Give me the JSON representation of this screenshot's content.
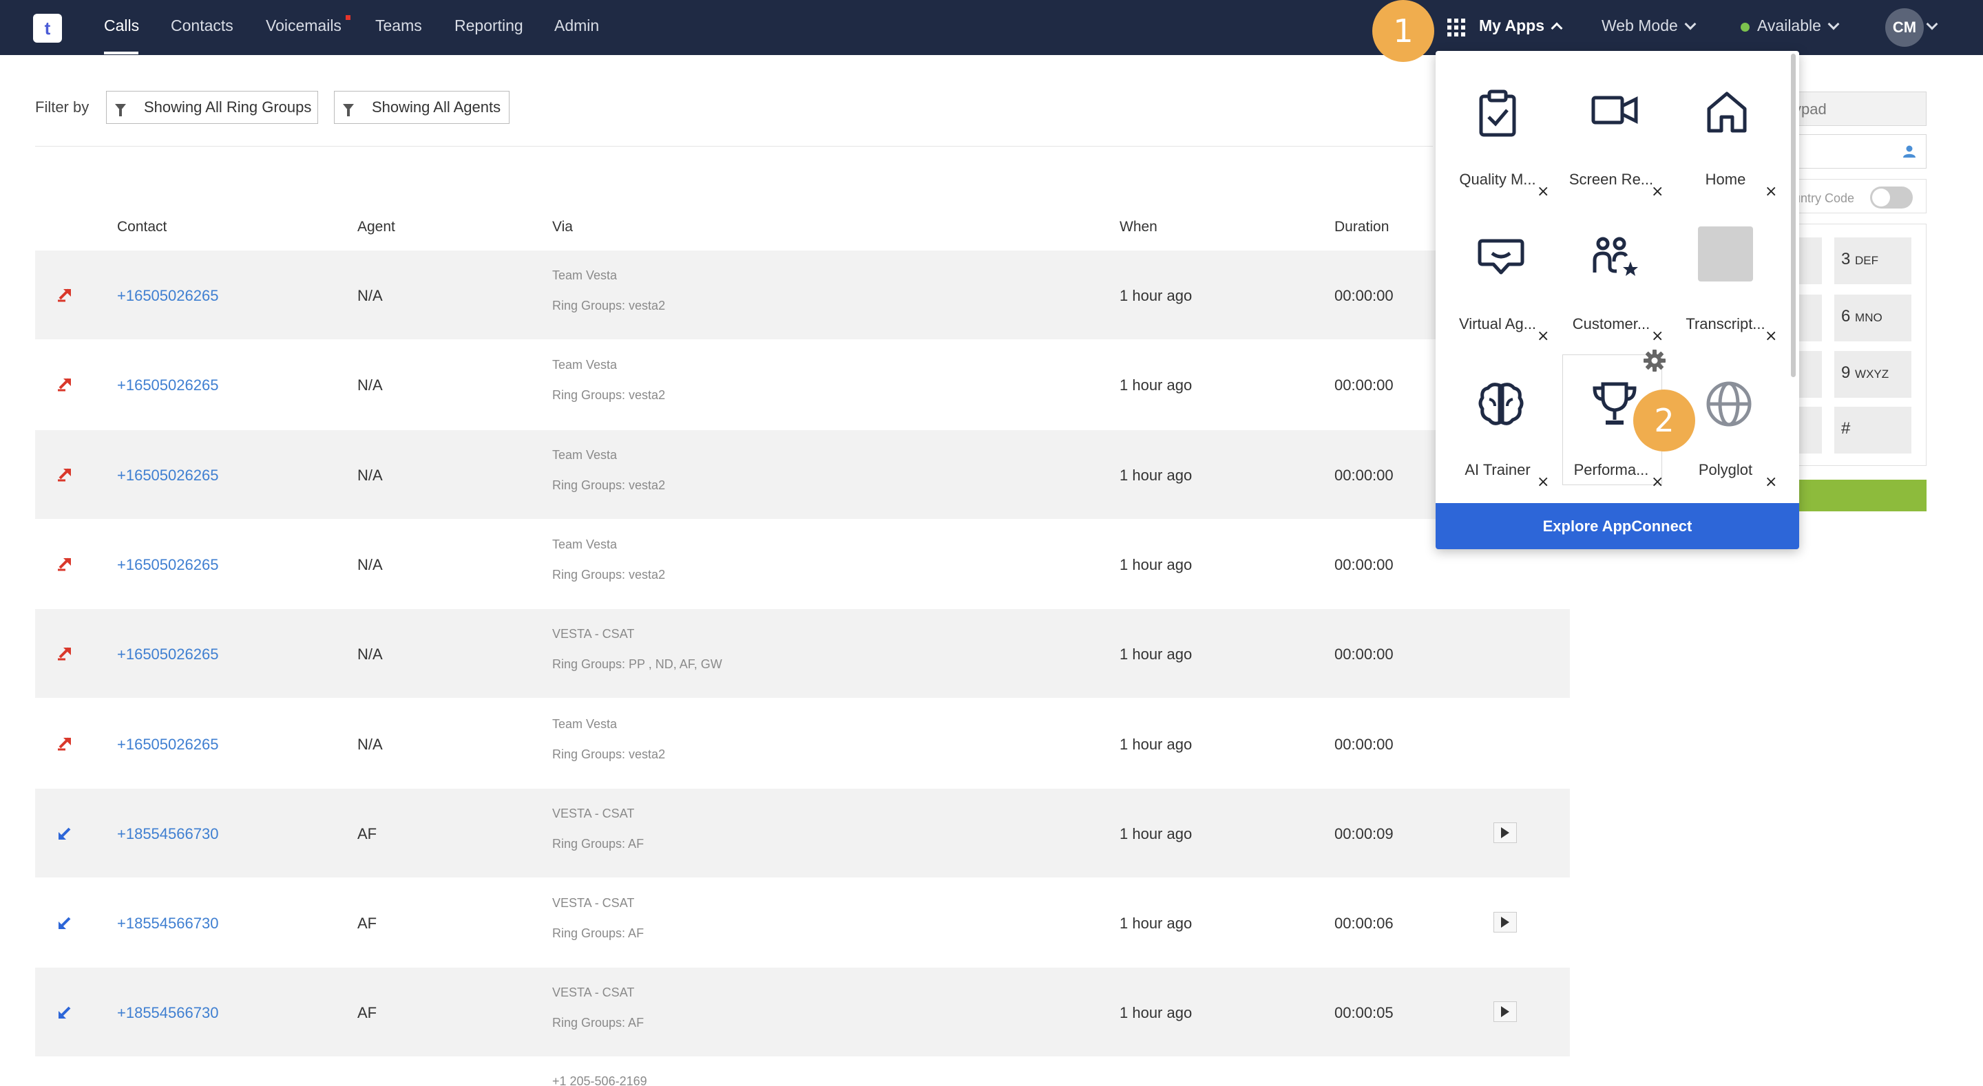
{
  "nav": {
    "logo_text": "t",
    "items": [
      {
        "label": "Calls"
      },
      {
        "label": "Contacts"
      },
      {
        "label": "Voicemails"
      },
      {
        "label": "Teams"
      },
      {
        "label": "Reporting"
      },
      {
        "label": "Admin"
      }
    ],
    "myapps_label": "My Apps",
    "webmode_label": "Web Mode",
    "status_label": "Available",
    "avatar_initials": "CM",
    "marker1": "1",
    "marker2": "2"
  },
  "filter": {
    "label": "Filter by",
    "ring_groups": "Showing All Ring Groups",
    "agents": "Showing All Agents"
  },
  "table": {
    "headers": {
      "contact": "Contact",
      "agent": "Agent",
      "via": "Via",
      "when": "When",
      "duration": "Duration"
    },
    "rows": [
      {
        "direction": "outbound",
        "contact": "+16505026265",
        "agent": "N/A",
        "via1": "Team Vesta",
        "via2": "Ring Groups: vesta2",
        "when": "1 hour ago",
        "duration": "00:00:00",
        "recording": false
      },
      {
        "direction": "outbound",
        "contact": "+16505026265",
        "agent": "N/A",
        "via1": "Team Vesta",
        "via2": "Ring Groups: vesta2",
        "when": "1 hour ago",
        "duration": "00:00:00",
        "recording": false
      },
      {
        "direction": "outbound",
        "contact": "+16505026265",
        "agent": "N/A",
        "via1": "Team Vesta",
        "via2": "Ring Groups: vesta2",
        "when": "1 hour ago",
        "duration": "00:00:00",
        "recording": false
      },
      {
        "direction": "outbound",
        "contact": "+16505026265",
        "agent": "N/A",
        "via1": "Team Vesta",
        "via2": "Ring Groups: vesta2",
        "when": "1 hour ago",
        "duration": "00:00:00",
        "recording": false
      },
      {
        "direction": "outbound",
        "contact": "+16505026265",
        "agent": "N/A",
        "via1": "VESTA - CSAT",
        "via2": "Ring Groups: PP , ND, AF, GW",
        "when": "1 hour ago",
        "duration": "00:00:00",
        "recording": false
      },
      {
        "direction": "outbound",
        "contact": "+16505026265",
        "agent": "N/A",
        "via1": "Team Vesta",
        "via2": "Ring Groups: vesta2",
        "when": "1 hour ago",
        "duration": "00:00:00",
        "recording": false
      },
      {
        "direction": "inbound",
        "contact": "+18554566730",
        "agent": "AF",
        "via1": "VESTA - CSAT",
        "via2": "Ring Groups: AF",
        "when": "1 hour ago",
        "duration": "00:00:09",
        "recording": true
      },
      {
        "direction": "inbound",
        "contact": "+18554566730",
        "agent": "AF",
        "via1": "VESTA - CSAT",
        "via2": "Ring Groups: AF",
        "when": "1 hour ago",
        "duration": "00:00:06",
        "recording": true
      },
      {
        "direction": "inbound",
        "contact": "+18554566730",
        "agent": "AF",
        "via1": "VESTA - CSAT",
        "via2": "Ring Groups: AF",
        "when": "1 hour ago",
        "duration": "00:00:05",
        "recording": true
      }
    ],
    "partial_row_via": "+1 205-506-2169"
  },
  "dialpad": {
    "input_partial": "ypad",
    "country_code_partial": "untry Code",
    "keys": [
      {
        "digit": "3",
        "letters": "DEF"
      },
      {
        "digit": "6",
        "letters": "MNO"
      },
      {
        "digit": "9",
        "letters": "WXYZ"
      },
      {
        "digit": "#",
        "letters": ""
      }
    ]
  },
  "apps": {
    "tiles": [
      {
        "label": "Quality M...",
        "icon": "clipboard-check-icon"
      },
      {
        "label": "Screen Re...",
        "icon": "video-camera-icon"
      },
      {
        "label": "Home",
        "icon": "home-icon"
      },
      {
        "label": "Virtual Ag...",
        "icon": "chat-bubble-icon"
      },
      {
        "label": "Customer...",
        "icon": "people-star-icon"
      },
      {
        "label": "Transcript...",
        "icon": "thumbnail-image"
      },
      {
        "label": "AI Trainer",
        "icon": "brain-icon"
      },
      {
        "label": "Performa...",
        "icon": "trophy-icon"
      },
      {
        "label": "Polyglot",
        "icon": "globe-icon"
      }
    ],
    "close_glyph": "×",
    "explore_label": "Explore AppConnect"
  },
  "colors": {
    "nav_bg": "#1f2a44",
    "link": "#3f7fd1",
    "accent_orange": "#f0ad4e",
    "explore_blue": "#2d66d8",
    "available_green": "#7cc24e"
  }
}
